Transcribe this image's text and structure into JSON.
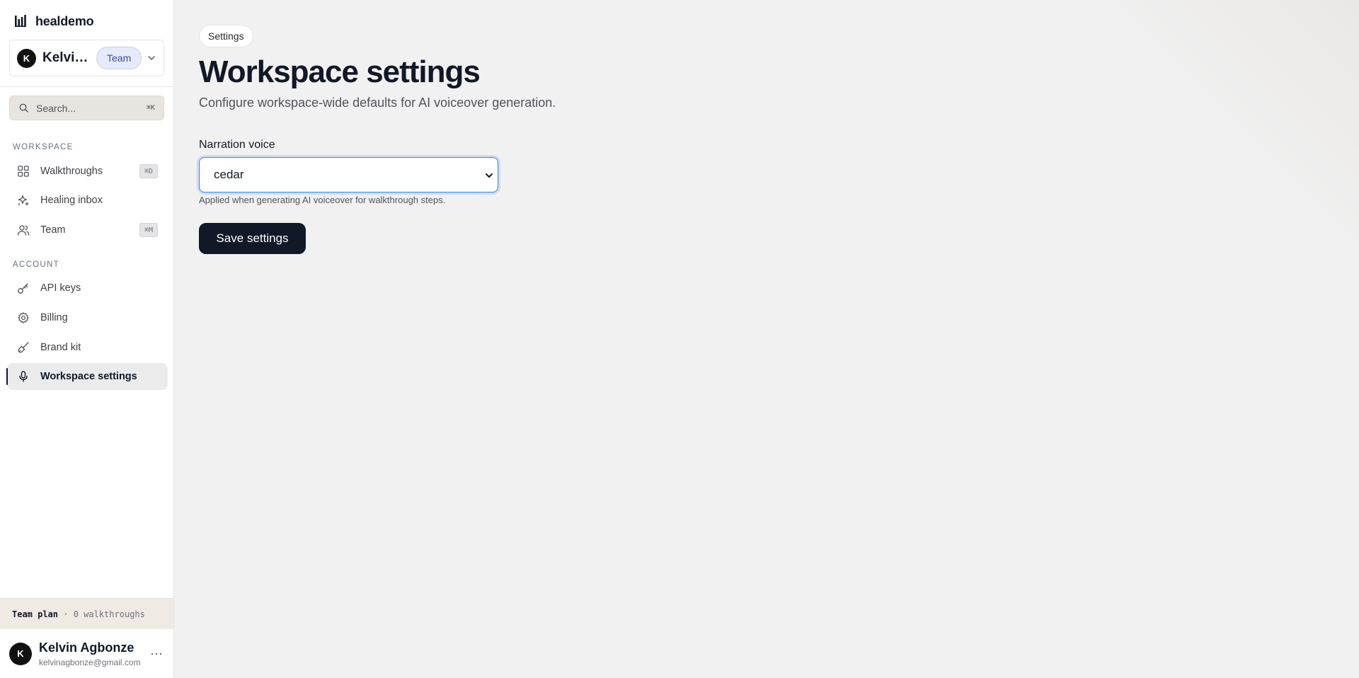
{
  "brand": {
    "name": "healdemo",
    "logo_icon": "bars-logo-icon"
  },
  "team_switcher": {
    "avatar_initial": "K",
    "name": "Kelvin Agbonze",
    "badge": "Team"
  },
  "search": {
    "placeholder": "Search...",
    "shortcut": "⌘K"
  },
  "sidebar": {
    "workspace_label": "WORKSPACE",
    "workspace_items": [
      {
        "label": "Walkthroughs",
        "icon": "grid-icon",
        "shortcut": "⌘D"
      },
      {
        "label": "Healing inbox",
        "icon": "sparkles-icon"
      },
      {
        "label": "Team",
        "icon": "users-icon",
        "shortcut": "⌘M"
      }
    ],
    "account_label": "ACCOUNT",
    "account_items": [
      {
        "label": "API keys",
        "icon": "key-icon"
      },
      {
        "label": "Billing",
        "icon": "gear-icon"
      },
      {
        "label": "Brand kit",
        "icon": "brush-icon"
      },
      {
        "label": "Workspace settings",
        "icon": "microphone-icon",
        "active": true
      }
    ],
    "plan": {
      "name": "Team plan",
      "detail": " · 0 walkthroughs"
    },
    "user": {
      "avatar_initial": "K",
      "name": "Kelvin Agbonze",
      "email": "kelvinagbonze@gmail.com"
    }
  },
  "main": {
    "breadcrumb": "Settings",
    "title": "Workspace settings",
    "subtitle": "Configure workspace-wide defaults for AI voiceover generation.",
    "narration": {
      "label": "Narration voice",
      "selected": "cedar",
      "help": "Applied when generating AI voiceover for walkthrough steps."
    },
    "save_label": "Save settings"
  },
  "colors": {
    "accent_dark": "#111827",
    "focus_ring": "#3b82f6",
    "badge_bg": "#e6ebfa",
    "badge_text": "#3b4a9c",
    "main_bg": "#f1f1f1"
  }
}
